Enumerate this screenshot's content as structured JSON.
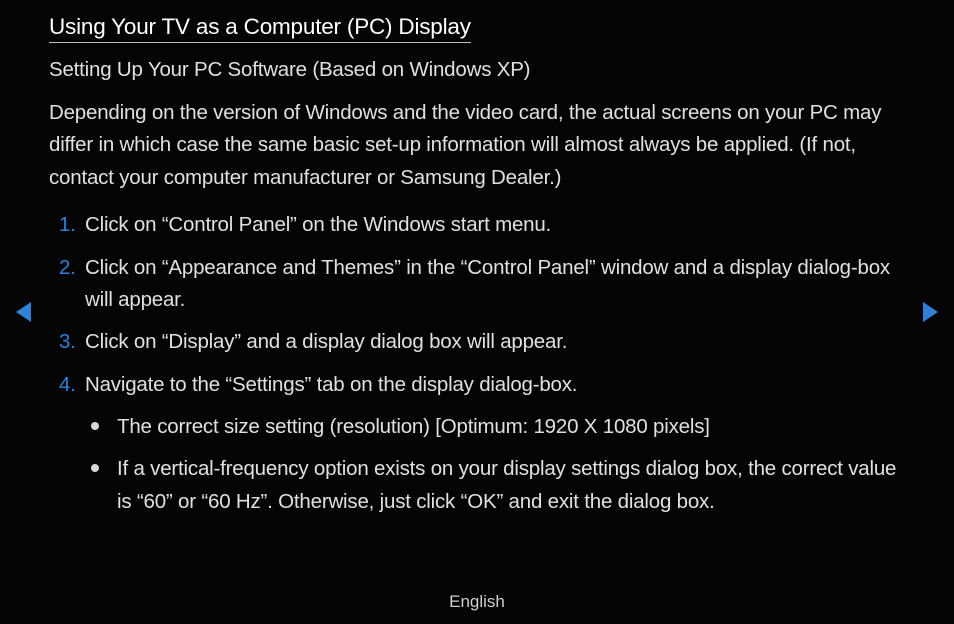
{
  "title": "Using Your TV as a Computer (PC) Display",
  "subtitle": "Setting Up Your PC Software (Based on Windows XP)",
  "intro": "Depending on the version of Windows and the video card, the actual screens on your PC may differ in which case the same basic set-up information will almost always be applied. (If not, contact your computer manufacturer or Samsung Dealer.)",
  "steps": [
    "Click on “Control Panel” on the Windows start menu.",
    "Click on “Appearance and Themes” in the “Control Panel” window and a display dialog-box will appear.",
    "Click on “Display” and a display dialog box will appear.",
    "Navigate to the “Settings” tab on the display dialog-box."
  ],
  "bullets": [
    "The correct size setting (resolution) [Optimum: 1920 X 1080 pixels]",
    "If a vertical-frequency option exists on your display settings dialog box, the correct value is “60” or “60 Hz”. Otherwise, just click “OK” and exit the dialog box."
  ],
  "language": "English"
}
